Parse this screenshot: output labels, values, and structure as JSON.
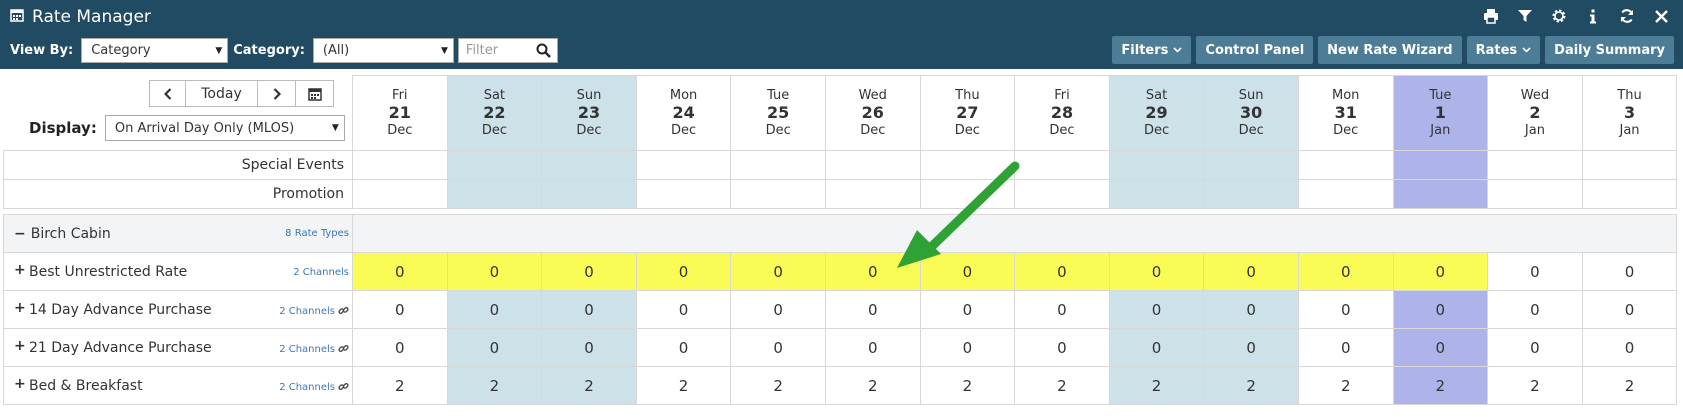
{
  "header": {
    "title": "Rate Manager",
    "icons": [
      "print-icon",
      "filter-icon",
      "gear-icon",
      "info-icon",
      "refresh-icon",
      "close-icon"
    ]
  },
  "toolbar": {
    "view_by_label": "View By:",
    "view_by_value": "Category",
    "category_label": "Category:",
    "category_value": "(All)",
    "filter_placeholder": "Filter"
  },
  "right_buttons": [
    "Filters",
    "Control Panel",
    "New Rate Wizard",
    "Rates",
    "Daily Summary"
  ],
  "nav": {
    "today_label": "Today",
    "display_label": "Display:",
    "display_value": "On Arrival Day Only (MLOS)"
  },
  "dates": [
    {
      "day": "Fri",
      "date": "21",
      "month": "Dec",
      "type": "normal"
    },
    {
      "day": "Sat",
      "date": "22",
      "month": "Dec",
      "type": "weekend"
    },
    {
      "day": "Sun",
      "date": "23",
      "month": "Dec",
      "type": "weekend"
    },
    {
      "day": "Mon",
      "date": "24",
      "month": "Dec",
      "type": "normal"
    },
    {
      "day": "Tue",
      "date": "25",
      "month": "Dec",
      "type": "normal"
    },
    {
      "day": "Wed",
      "date": "26",
      "month": "Dec",
      "type": "normal"
    },
    {
      "day": "Thu",
      "date": "27",
      "month": "Dec",
      "type": "normal"
    },
    {
      "day": "Fri",
      "date": "28",
      "month": "Dec",
      "type": "normal"
    },
    {
      "day": "Sat",
      "date": "29",
      "month": "Dec",
      "type": "weekend"
    },
    {
      "day": "Sun",
      "date": "30",
      "month": "Dec",
      "type": "weekend"
    },
    {
      "day": "Mon",
      "date": "31",
      "month": "Dec",
      "type": "normal"
    },
    {
      "day": "Tue",
      "date": "1",
      "month": "Jan",
      "type": "holiday"
    },
    {
      "day": "Wed",
      "date": "2",
      "month": "Jan",
      "type": "normal"
    },
    {
      "day": "Thu",
      "date": "3",
      "month": "Jan",
      "type": "normal"
    }
  ],
  "event_rows": [
    "Special Events",
    "Promotion"
  ],
  "section": {
    "collapse_symbol": "−",
    "name": "Birch Cabin",
    "rate_types": "8 Rate Types"
  },
  "rates": [
    {
      "name": "Best Unrestricted Rate",
      "channels": "2 Channels",
      "linked": false,
      "highlight_count": 12,
      "values": [
        "0",
        "0",
        "0",
        "0",
        "0",
        "0",
        "0",
        "0",
        "0",
        "0",
        "0",
        "0",
        "0",
        "0"
      ]
    },
    {
      "name": "14 Day Advance Purchase",
      "channels": "2 Channels",
      "linked": true,
      "highlight_count": 0,
      "values": [
        "0",
        "0",
        "0",
        "0",
        "0",
        "0",
        "0",
        "0",
        "0",
        "0",
        "0",
        "0",
        "0",
        "0"
      ]
    },
    {
      "name": "21 Day Advance Purchase",
      "channels": "2 Channels",
      "linked": true,
      "highlight_count": 0,
      "values": [
        "0",
        "0",
        "0",
        "0",
        "0",
        "0",
        "0",
        "0",
        "0",
        "0",
        "0",
        "0",
        "0",
        "0"
      ]
    },
    {
      "name": "Bed & Breakfast",
      "channels": "2 Channels",
      "linked": true,
      "highlight_count": 0,
      "values": [
        "2",
        "2",
        "2",
        "2",
        "2",
        "2",
        "2",
        "2",
        "2",
        "2",
        "2",
        "2",
        "2",
        "2"
      ]
    }
  ],
  "colors": {
    "header_bg": "#214b63",
    "button_bg": "#4d7c96",
    "weekend": "#cce1e8",
    "holiday": "#aeb4ea",
    "highlight": "#fbfb56",
    "annotation_arrow": "#2ea234"
  }
}
